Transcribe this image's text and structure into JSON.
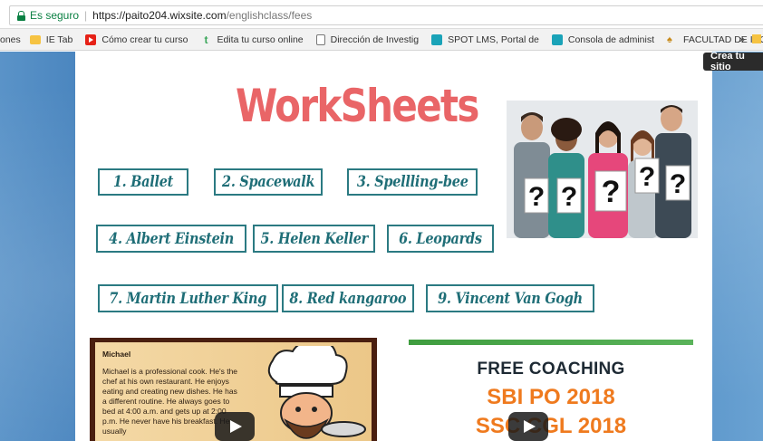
{
  "browser": {
    "secure_label": "Es seguro",
    "url_host": "https://paito204.wixsite.com",
    "url_path": "/englishclass/fees"
  },
  "bookmarks": [
    {
      "label": "ones",
      "icon": "none"
    },
    {
      "label": "IE Tab",
      "icon": "folder-icon"
    },
    {
      "label": "Cómo crear tu curso",
      "icon": "youtube-icon"
    },
    {
      "label": "Edita tu curso online",
      "icon": "t-icon"
    },
    {
      "label": "Dirección de Investig",
      "icon": "page-icon"
    },
    {
      "label": "SPOT LMS, Portal de",
      "icon": "spot-icon"
    },
    {
      "label": "Consola de administ",
      "icon": "spot-icon"
    },
    {
      "label": "FACULTAD DE INGE",
      "icon": "faculty-icon"
    }
  ],
  "bookmarks_more": "»",
  "wix_tooltip": "Crea tu sitio",
  "title": "WorkSheets",
  "worksheets": [
    "1. Ballet",
    "2. Spacewalk",
    "3. Spellling-bee",
    "4. Albert Einstein",
    "5. Helen Keller",
    "6. Leopards",
    "7. Martin Luther King",
    "8. Red kangaroo",
    "9. Vincent Van Gogh"
  ],
  "video1": {
    "name": "Michael",
    "text": "Michael is a professional cook. He's the chef at his own restaurant. He enjoys eating and creating new dishes. He has a different routine. He always goes to bed at 4:00 a.m. and gets up at 2:00 p.m. He never have his breakfast. He usually"
  },
  "video2": {
    "line1": "FREE COACHING",
    "line2": "SBI PO 2018",
    "line3": "SSC CGL 2018"
  },
  "colors": {
    "title": "#e96567",
    "button_border": "#2b7a82",
    "accent_orange": "#ef7a1e"
  }
}
